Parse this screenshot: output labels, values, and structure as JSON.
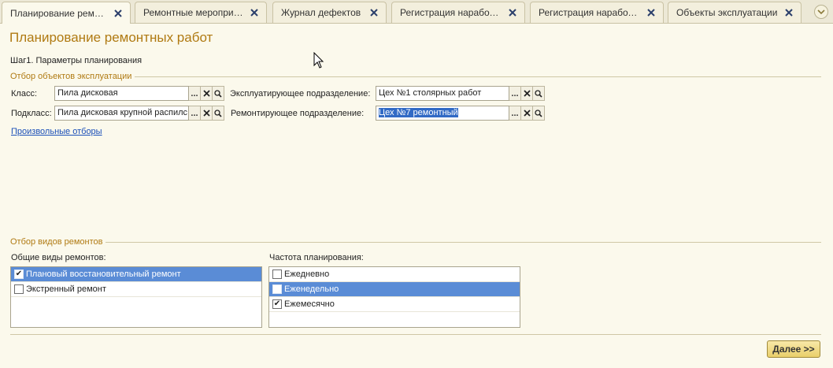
{
  "tabs": [
    {
      "label": "Планирование ремонтн...",
      "active": true
    },
    {
      "label": "Ремонтные мероприятия",
      "active": false
    },
    {
      "label": "Журнал дефектов",
      "active": false
    },
    {
      "label": "Регистрация наработок ...",
      "active": false
    },
    {
      "label": "Регистрация наработок ...",
      "active": false
    },
    {
      "label": "Объекты эксплуатации",
      "active": false
    }
  ],
  "page": {
    "title": "Планирование ремонтных работ",
    "step": "Шаг1. Параметры планирования"
  },
  "objects_filter": {
    "caption": "Отбор объектов эксплуатации",
    "class_label": "Класс:",
    "class_value": "Пила дисковая",
    "subclass_label": "Подкласс:",
    "subclass_value": "Пила дисковая крупной распилс",
    "operating_unit_label": "Эксплуатирующее подразделение:",
    "operating_unit_value": "Цех №1 столярных работ",
    "repair_unit_label": "Ремонтирующее подразделение:",
    "repair_unit_value": "Цех №7 ремонтный",
    "custom_filters_link": "Произвольные отборы"
  },
  "repair_types_filter": {
    "caption": "Отбор видов ремонтов",
    "general_label": "Общие виды ремонтов:",
    "general_items": [
      {
        "label": "Плановый восстановительный ремонт",
        "checked": true,
        "selected": true
      },
      {
        "label": "Экстренный ремонт",
        "checked": false,
        "selected": false
      }
    ],
    "frequency_label": "Частота планирования:",
    "frequency_items": [
      {
        "label": "Ежедневно",
        "checked": false,
        "selected": false
      },
      {
        "label": "Еженедельно",
        "checked": false,
        "selected": true
      },
      {
        "label": "Ежемесячно",
        "checked": true,
        "selected": false
      }
    ]
  },
  "buttons": {
    "next": "Далее >>",
    "ellipsis": "...",
    "clear": "✕"
  },
  "colors": {
    "accent_title": "#b07a12",
    "selection": "#5a8cd6",
    "link": "#1a4fb8"
  }
}
